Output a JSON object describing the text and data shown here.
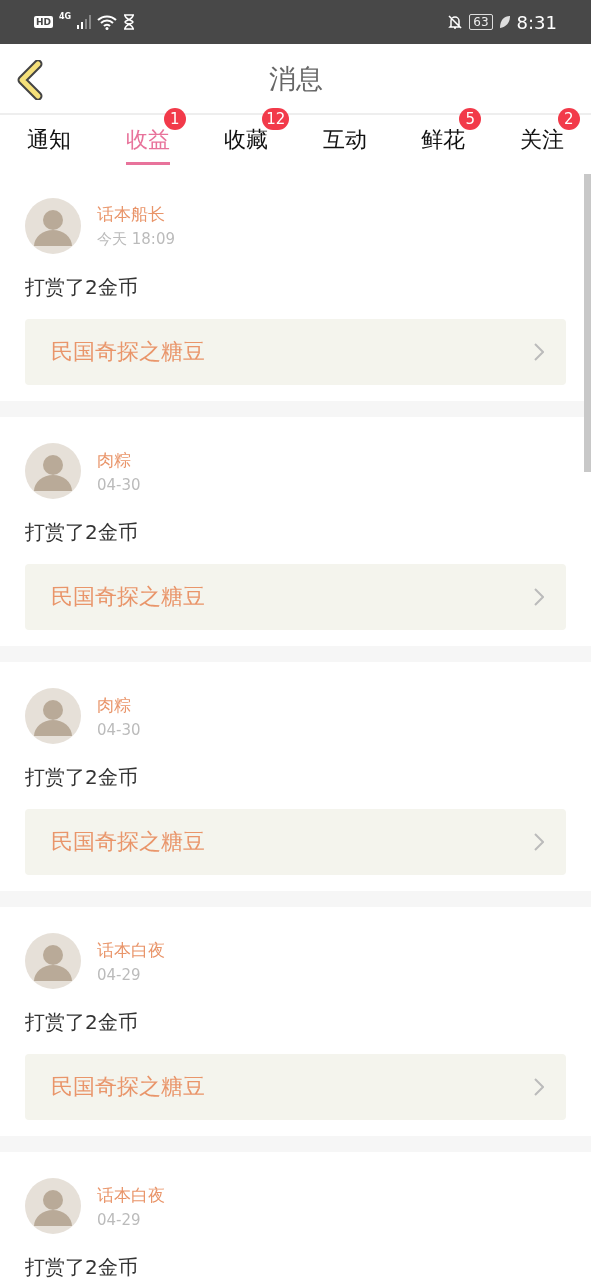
{
  "status_bar": {
    "hd": "HD",
    "network": "4G",
    "battery": "63",
    "time": "8:31"
  },
  "header": {
    "title": "消息"
  },
  "tabs": [
    {
      "label": "通知",
      "selected": false
    },
    {
      "label": "收益",
      "selected": true,
      "badge": "1"
    },
    {
      "label": "收藏",
      "selected": false,
      "badge": "12"
    },
    {
      "label": "互动",
      "selected": false
    },
    {
      "label": "鲜花",
      "selected": false,
      "badge": "5"
    },
    {
      "label": "关注",
      "selected": false,
      "badge": "2"
    }
  ],
  "messages": [
    {
      "user": "话本船长",
      "time": "今天 18:09",
      "text": "打赏了2金币",
      "book": "民国奇探之糖豆"
    },
    {
      "user": "肉粽",
      "time": "04-30",
      "text": "打赏了2金币",
      "book": "民国奇探之糖豆"
    },
    {
      "user": "肉粽",
      "time": "04-30",
      "text": "打赏了2金币",
      "book": "民国奇探之糖豆"
    },
    {
      "user": "话本白夜",
      "time": "04-29",
      "text": "打赏了2金币",
      "book": "民国奇探之糖豆"
    },
    {
      "user": "话本白夜",
      "time": "04-29",
      "text": "打赏了2金币"
    }
  ]
}
